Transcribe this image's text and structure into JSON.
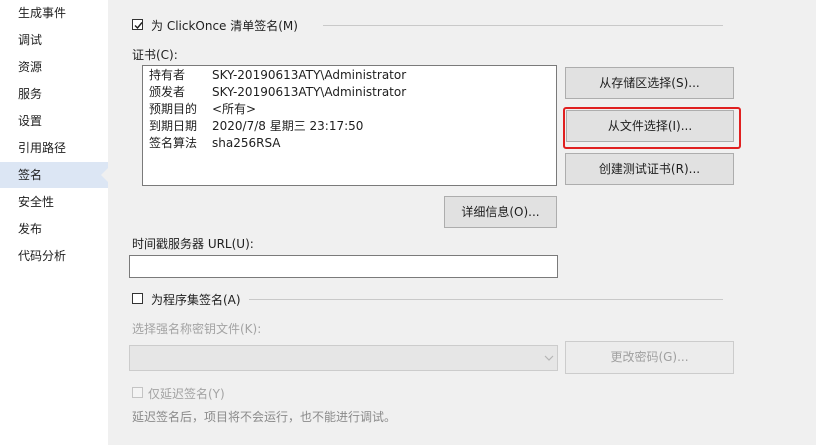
{
  "sidebar": {
    "items": [
      {
        "label": "生成事件"
      },
      {
        "label": "调试"
      },
      {
        "label": "资源"
      },
      {
        "label": "服务"
      },
      {
        "label": "设置"
      },
      {
        "label": "引用路径"
      },
      {
        "label": "签名"
      },
      {
        "label": "安全性"
      },
      {
        "label": "发布"
      },
      {
        "label": "代码分析"
      }
    ],
    "active_index": 6
  },
  "clickonce": {
    "label": "为 ClickOnce 清单签名(M)",
    "checked": true
  },
  "certificate": {
    "label": "证书(C):",
    "rows": [
      {
        "key": "持有者",
        "value": "SKY-20190613ATY\\Administrator"
      },
      {
        "key": "颁发者",
        "value": "SKY-20190613ATY\\Administrator"
      },
      {
        "key": "预期目的",
        "value": "<所有>"
      },
      {
        "key": "到期日期",
        "value": "2020/7/8 星期三 23:17:50"
      },
      {
        "key": "签名算法",
        "value": "sha256RSA"
      }
    ],
    "buttons": {
      "from_store": "从存储区选择(S)...",
      "from_file": "从文件选择(I)...",
      "create_test": "创建测试证书(R)...",
      "details": "详细信息(O)..."
    }
  },
  "timestamp": {
    "label": "时间戳服务器 URL(U):",
    "value": ""
  },
  "assembly": {
    "label": "为程序集签名(A)",
    "checked": false,
    "key_file_label": "选择强名称密钥文件(K):",
    "key_file_value": "",
    "change_password": "更改密码(G)...",
    "delay_sign_label": "仅延迟签名(Y)",
    "delay_sign_checked": false,
    "delay_note": "延迟签名后，项目将不会运行，也不能进行调试。"
  },
  "colors": {
    "highlight": "#e02020",
    "active_nav": "#dce6f4"
  }
}
